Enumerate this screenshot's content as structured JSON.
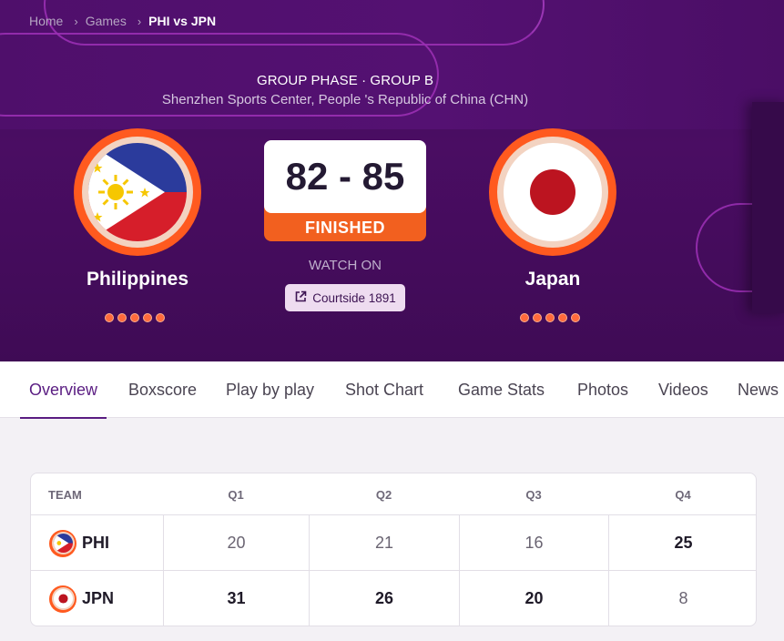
{
  "breadcrumb": {
    "home": "Home",
    "games": "Games",
    "current": "PHI vs JPN",
    "separator": "›"
  },
  "match": {
    "phase": "GROUP PHASE · GROUP B",
    "venue": "Shenzhen Sports Center, People 's Republic of China (CHN)",
    "score": "82 - 85",
    "status": "FINISHED",
    "watch_on": "WATCH ON",
    "watch_button": "Courtside 1891"
  },
  "teams": {
    "home": {
      "name": "Philippines",
      "code": "PHI",
      "flag_icon": "philippines-flag-icon",
      "form_dots": 5
    },
    "away": {
      "name": "Japan",
      "code": "JPN",
      "flag_icon": "japan-flag-icon",
      "form_dots": 5
    }
  },
  "tabs": [
    "Overview",
    "Boxscore",
    "Play by play",
    "Shot Chart",
    "Game Stats",
    "Photos",
    "Videos",
    "News"
  ],
  "active_tab": "Overview",
  "quarters_table": {
    "headers": [
      "TEAM",
      "Q1",
      "Q2",
      "Q3",
      "Q4"
    ],
    "rows": [
      {
        "team": "PHI",
        "scores": [
          "20",
          "21",
          "16",
          "25"
        ]
      },
      {
        "team": "JPN",
        "scores": [
          "31",
          "26",
          "20",
          "8"
        ]
      }
    ]
  },
  "colors": {
    "hero_bg": "#4a0d63",
    "accent_orange": "#f2601f",
    "active_tab": "#5a1d82",
    "ph_blue": "#2b3b9c",
    "ph_red": "#d61e2a",
    "ph_sun": "#f6c700",
    "jp_red": "#bc1420"
  }
}
